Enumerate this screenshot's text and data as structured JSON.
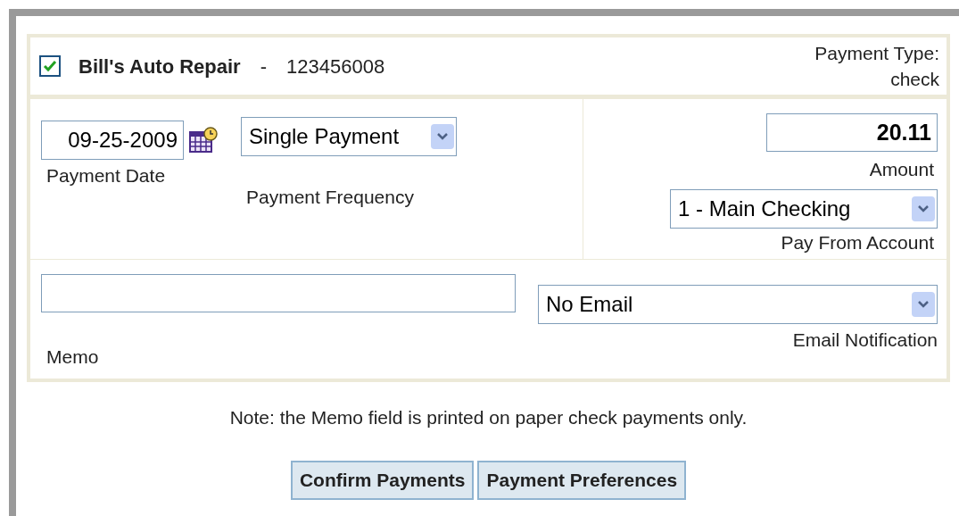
{
  "payee": {
    "checked": true,
    "name": "Bill's Auto Repair",
    "separator": "-",
    "account_number": "123456008"
  },
  "payment_type": {
    "label": "Payment Type:",
    "value": "check"
  },
  "payment_date": {
    "value": "09-25-2009",
    "label": "Payment Date"
  },
  "payment_frequency": {
    "value": "Single Payment",
    "label": "Payment Frequency"
  },
  "amount": {
    "value": "20.11",
    "label": "Amount"
  },
  "pay_from_account": {
    "value": "1 - Main Checking",
    "label": "Pay From Account"
  },
  "memo": {
    "label": "Memo"
  },
  "email_notification": {
    "value": "No Email",
    "label": "Email Notification"
  },
  "note": "Note: the Memo field is printed on paper check payments only.",
  "buttons": [
    "Confirm Payments",
    "Payment Preferences"
  ]
}
